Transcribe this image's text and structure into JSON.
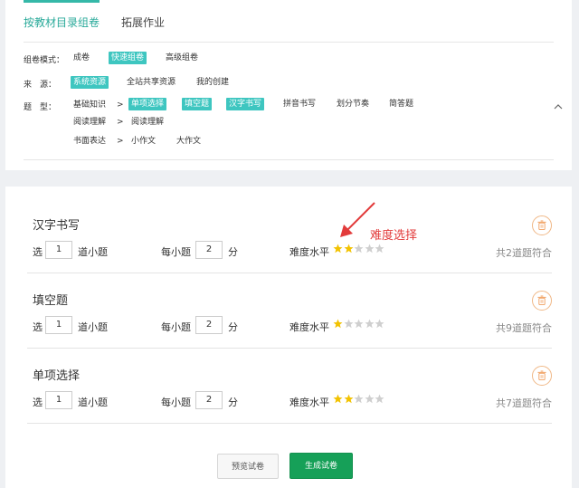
{
  "tabs": [
    {
      "label": "按教材目录组卷",
      "active": true
    },
    {
      "label": "拓展作业",
      "active": false
    }
  ],
  "filters": {
    "mode": {
      "label": "组卷模式：",
      "options": [
        "成卷",
        "快速组卷",
        "高级组卷"
      ],
      "selected": "快速组卷"
    },
    "source": {
      "label": "来　源：",
      "options": [
        "系统资源",
        "全站共享资源",
        "我的创建"
      ],
      "selected": "系统资源"
    },
    "type": {
      "label": "题　型：",
      "groups": [
        {
          "name": "基础知识",
          "separator": ">",
          "items": [
            "单项选择",
            "填空题",
            "汉字书写",
            "拼音书写",
            "划分节奏",
            "简答题"
          ],
          "selected": [
            "单项选择",
            "填空题",
            "汉字书写"
          ]
        },
        {
          "name": "阅读理解",
          "separator": ">",
          "items": [
            "阅读理解"
          ],
          "selected": []
        },
        {
          "name": "书面表达",
          "separator": ">",
          "items": [
            "小作文",
            "大作文"
          ],
          "selected": []
        }
      ]
    },
    "collapse_icon": "chevron-up-icon"
  },
  "questions": [
    {
      "title": "汉字书写",
      "select_prefix": "选",
      "count": "1",
      "count_suffix": "道小题",
      "each_prefix": "每小题",
      "score": "2",
      "score_suffix": "分",
      "difficulty_label": "难度水平",
      "difficulty": 2,
      "difficulty_max": 5,
      "match_text": "共2道题符合"
    },
    {
      "title": "填空题",
      "select_prefix": "选",
      "count": "1",
      "count_suffix": "道小题",
      "each_prefix": "每小题",
      "score": "2",
      "score_suffix": "分",
      "difficulty_label": "难度水平",
      "difficulty": 1,
      "difficulty_max": 5,
      "match_text": "共9道题符合"
    },
    {
      "title": "单项选择",
      "select_prefix": "选",
      "count": "1",
      "count_suffix": "道小题",
      "each_prefix": "每小题",
      "score": "2",
      "score_suffix": "分",
      "difficulty_label": "难度水平",
      "difficulty": 2,
      "difficulty_max": 5,
      "match_text": "共7道题符合"
    }
  ],
  "annotation": {
    "text": "难度选择",
    "color": "#e23b3b"
  },
  "buttons": {
    "preview": "预览试卷",
    "generate": "生成试卷"
  },
  "colors": {
    "accent": "#3ec6c0",
    "tab_active": "#2aaa9a",
    "generate": "#16a058",
    "star_on": "#f2c200",
    "star_off": "#cfcfcf",
    "delete": "#f0b887"
  }
}
